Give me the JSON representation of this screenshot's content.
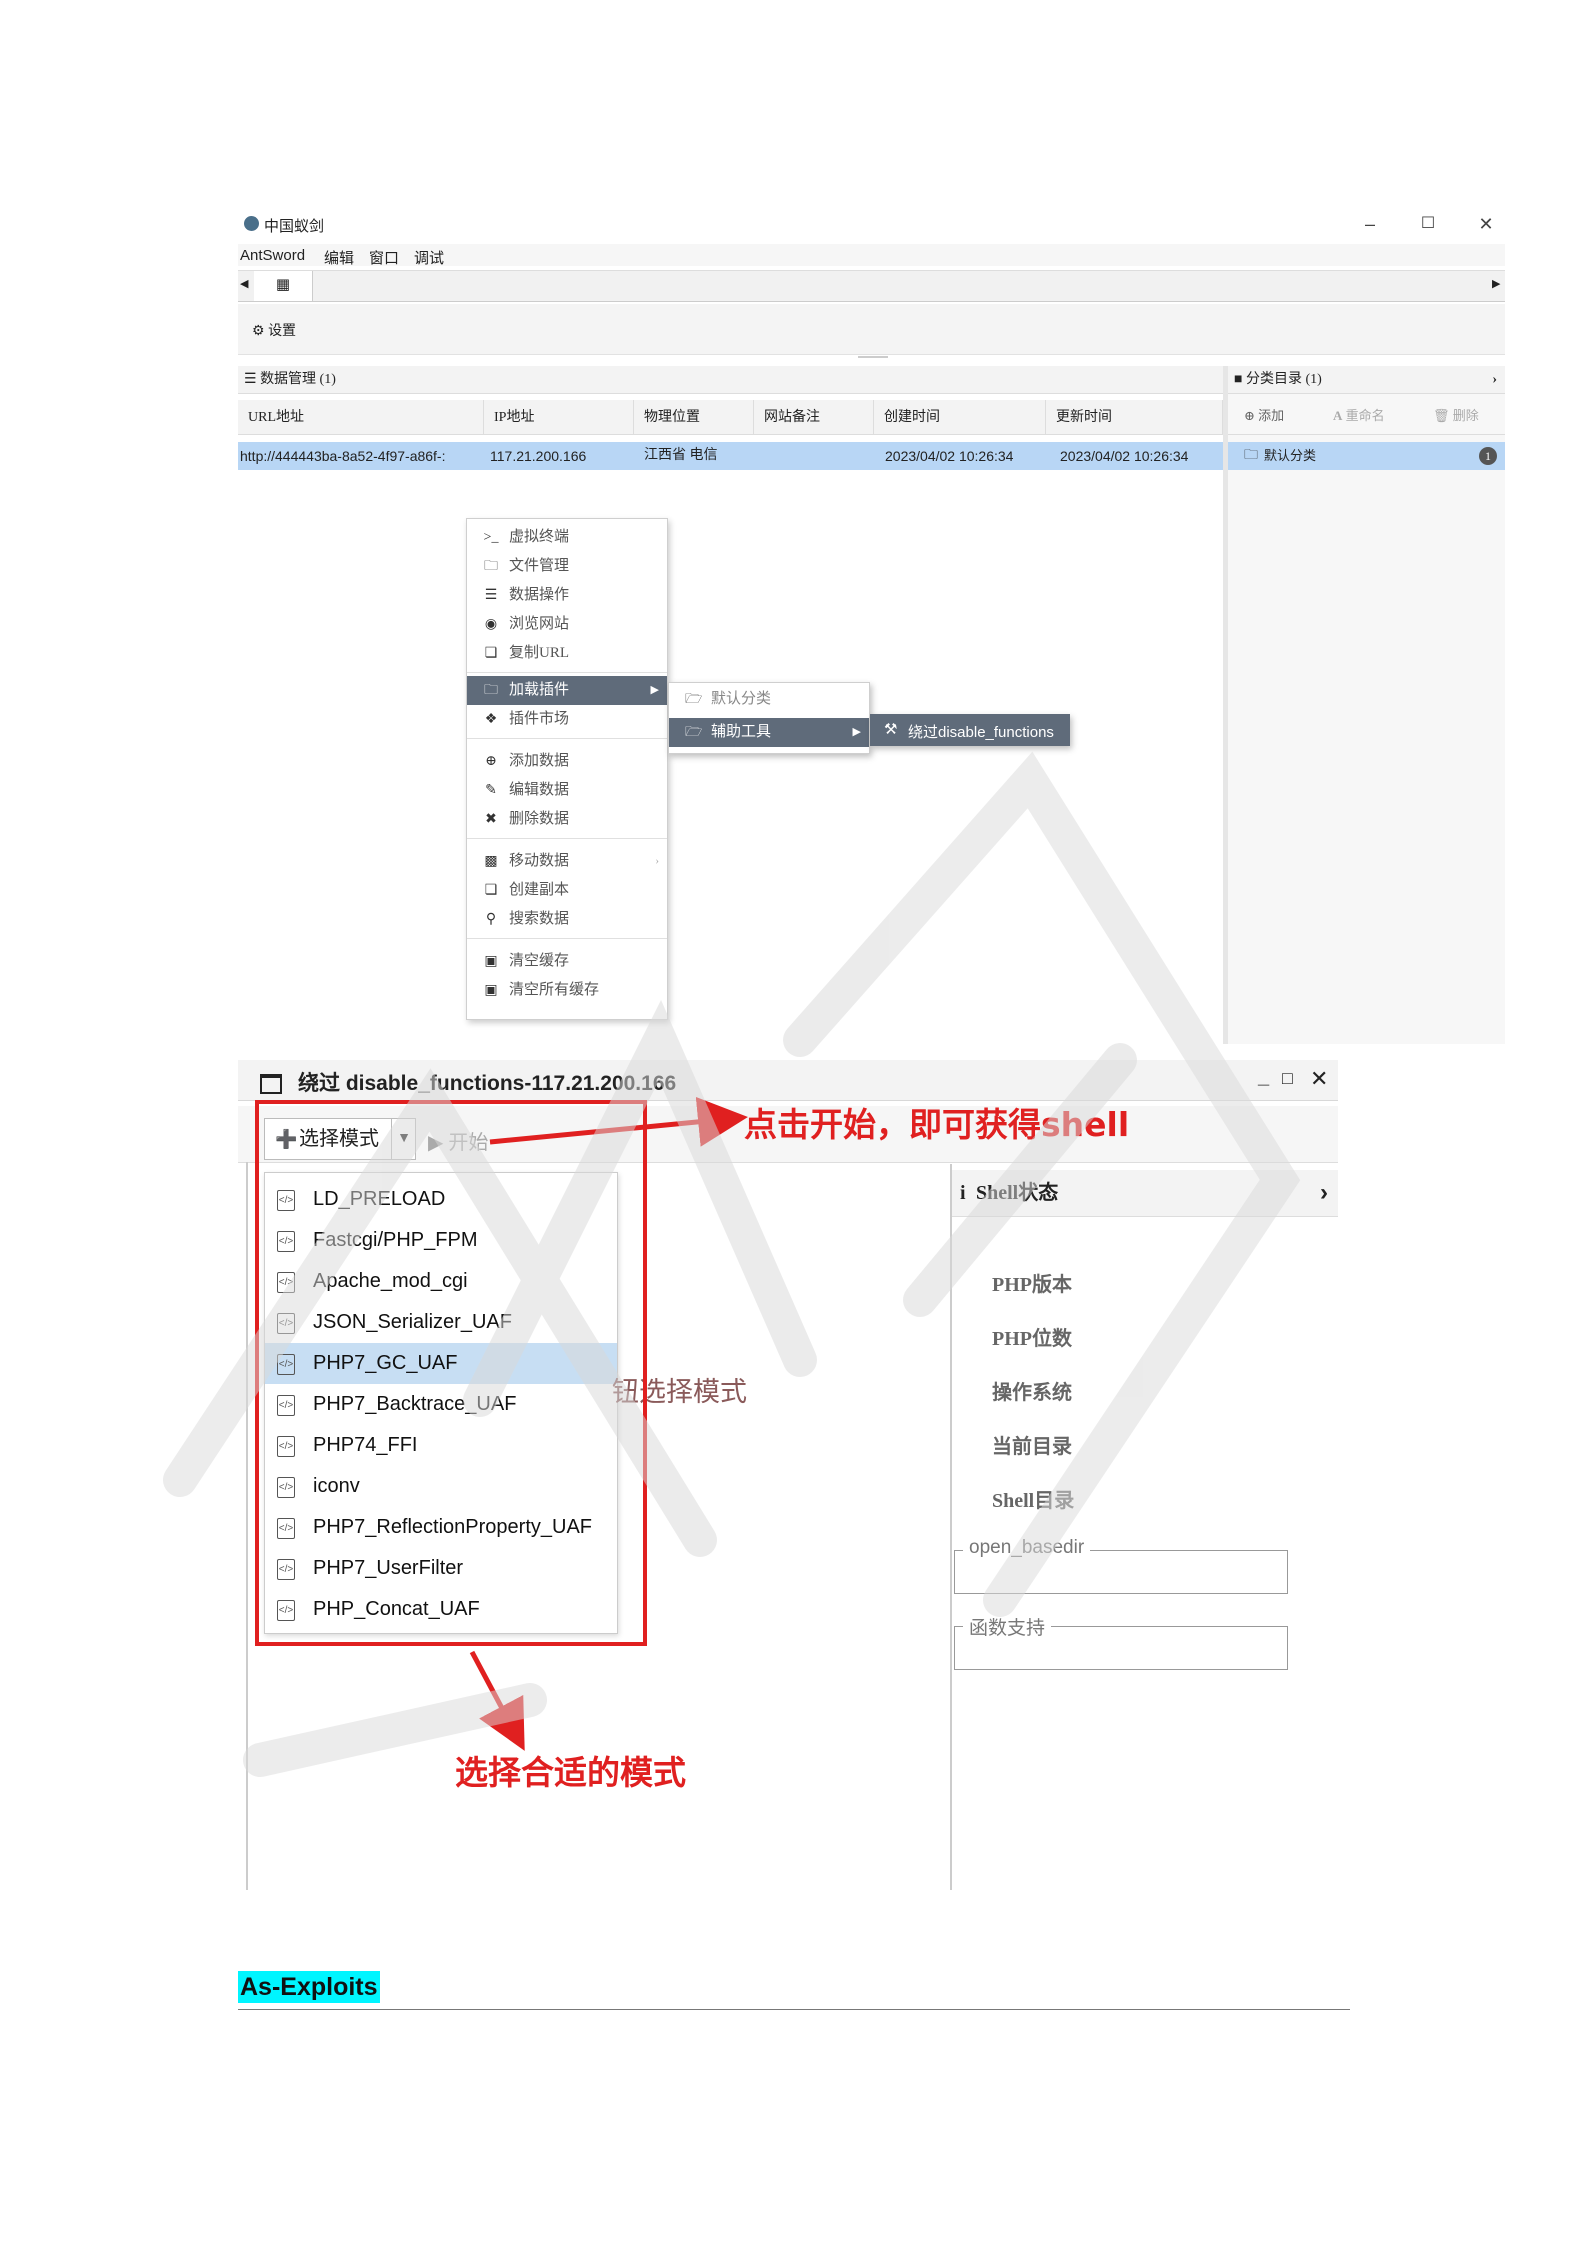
{
  "window1": {
    "title": "中国蚁剑",
    "menu": [
      "AntSword",
      "编辑",
      "窗口",
      "调试"
    ],
    "toolbar_settings": "设置",
    "data_panel_title": "数据管理 (1)",
    "columns": [
      "URL地址",
      "IP地址",
      "物理位置",
      "网站备注",
      "创建时间",
      "更新时间"
    ],
    "row": {
      "url": "http://444443ba-8a52-4f97-a86f-:",
      "ip": "117.21.200.166",
      "location": "江西省 电信",
      "note": "",
      "created": "2023/04/02 10:26:34",
      "updated": "2023/04/02 10:26:34"
    },
    "category_panel_title": "分类目录 (1)",
    "category_actions": [
      "添加",
      "重命名",
      "删除"
    ],
    "category_default": "默认分类",
    "category_count": "1",
    "context_menu": [
      "虚拟终端",
      "文件管理",
      "数据操作",
      "浏览网站",
      "复制URL",
      "加载插件",
      "插件市场",
      "添加数据",
      "编辑数据",
      "删除数据",
      "移动数据",
      "创建副本",
      "搜索数据",
      "清空缓存",
      "清空所有缓存"
    ],
    "submenu1": [
      "默认分类",
      "辅助工具"
    ],
    "submenu2": "绕过disable_functions"
  },
  "window2": {
    "title": "绕过 disable_functions-117.21.200.166",
    "select_mode": "选择模式",
    "start": "开始",
    "modes": [
      "LD_PRELOAD",
      "Fastcgi/PHP_FPM",
      "Apache_mod_cgi",
      "JSON_Serializer_UAF",
      "PHP7_GC_UAF",
      "PHP7_Backtrace_UAF",
      "PHP74_FFI",
      "iconv",
      "PHP7_ReflectionProperty_UAF",
      "PHP7_UserFilter",
      "PHP_Concat_UAF"
    ],
    "selected_mode": "PHP7_GC_UAF",
    "hint_text": "钮选择模式",
    "shell_status_title": "Shell状态",
    "info_labels": [
      "PHP版本",
      "PHP位数",
      "操作系统",
      "当前目录",
      "Shell目录"
    ],
    "fieldsets": [
      "open_basedir",
      "函数支持"
    ]
  },
  "annotations": {
    "click_start": "点击开始，即可获得shell",
    "choose_mode": "选择合适的模式"
  },
  "section_heading": "As-Exploits",
  "colors": {
    "selection": "#b8d6f5",
    "menu_selected": "#5f6b7a",
    "annotation_red": "#e02020",
    "heading_highlight": "#00f5ff"
  }
}
